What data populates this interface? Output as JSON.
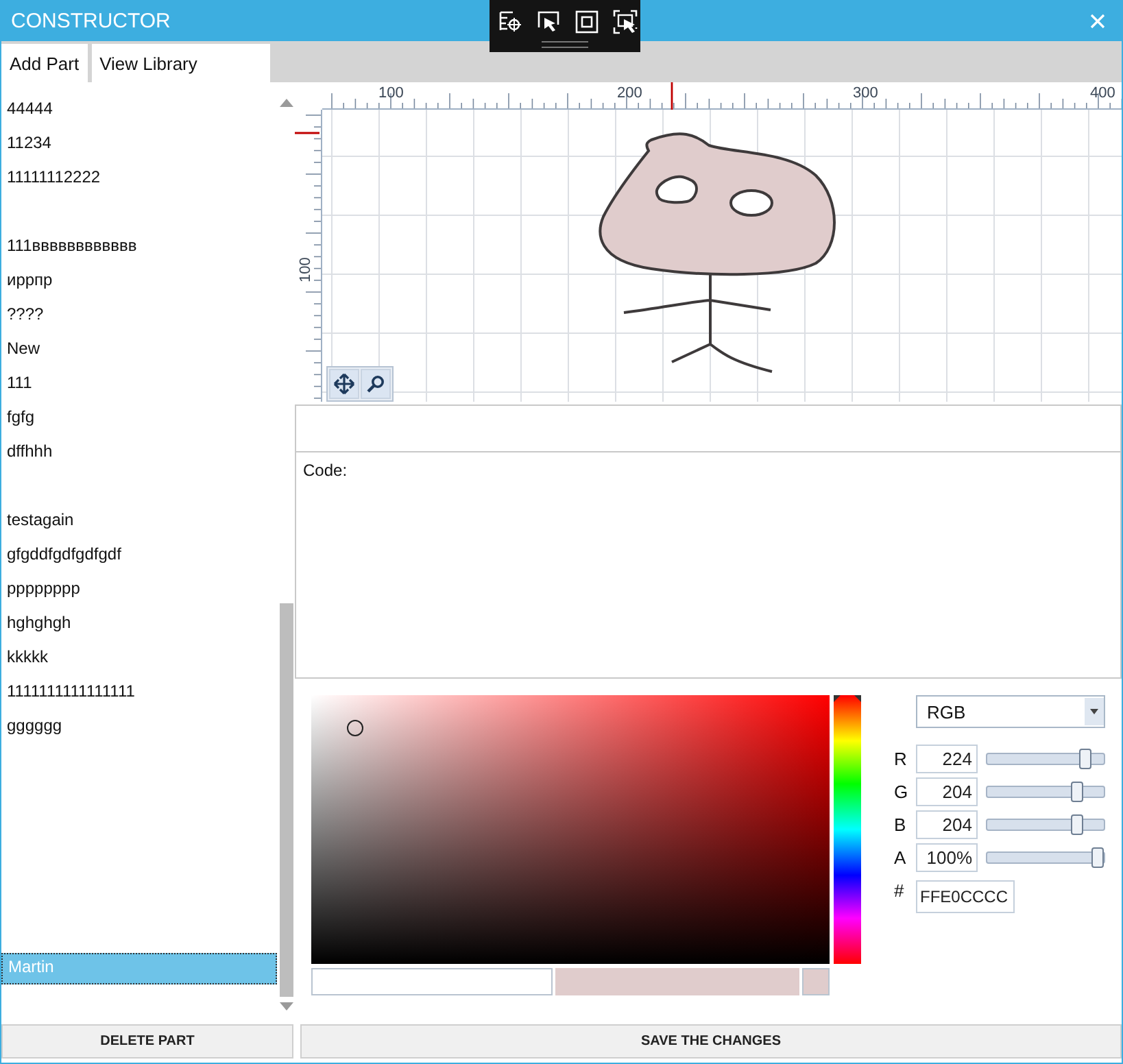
{
  "window": {
    "title": "CONSTRUCTOR"
  },
  "toolbar": [
    {
      "label": "Add Part"
    },
    {
      "label": "View Library"
    }
  ],
  "parts": [
    {
      "name": "44444",
      "spaced": false,
      "kind": "part",
      "selected": false
    },
    {
      "name": "11234",
      "spaced": false,
      "kind": "part",
      "selected": false
    },
    {
      "name": "11111112222",
      "spaced": false,
      "kind": "part",
      "selected": false
    },
    {
      "name": "111вввввввввввв",
      "spaced": true,
      "kind": "part",
      "selected": false
    },
    {
      "name": "иррпр",
      "spaced": false,
      "kind": "part",
      "selected": false
    },
    {
      "name": "????",
      "spaced": false,
      "kind": "part",
      "selected": false
    },
    {
      "name": "New",
      "spaced": false,
      "kind": "part",
      "selected": false
    },
    {
      "name": "111",
      "spaced": false,
      "kind": "part",
      "selected": false
    },
    {
      "name": "fgfg",
      "spaced": false,
      "kind": "part",
      "selected": false
    },
    {
      "name": "dffhhh",
      "spaced": false,
      "kind": "part",
      "selected": false
    },
    {
      "name": "testagain",
      "spaced": true,
      "kind": "part",
      "selected": false
    },
    {
      "name": "gfgddfgdfgdfgdf",
      "spaced": false,
      "kind": "part",
      "selected": false
    },
    {
      "name": "pppppppp",
      "spaced": false,
      "kind": "part",
      "selected": false
    },
    {
      "name": "hghghgh",
      "spaced": false,
      "kind": "part",
      "selected": false
    },
    {
      "name": "kkkkk",
      "spaced": false,
      "kind": "part",
      "selected": false
    },
    {
      "name": "1111111111111111",
      "spaced": false,
      "kind": "part",
      "selected": false
    },
    {
      "name": "gggggg",
      "spaced": false,
      "kind": "part",
      "selected": false
    },
    {
      "name": "Martin",
      "spaced": false,
      "kind": "pinned",
      "selected": true
    }
  ],
  "ruler": {
    "x_labels": [
      "100",
      "200",
      "300",
      "400"
    ],
    "y_labels": [
      "100"
    ]
  },
  "code": {
    "label": "Code:"
  },
  "color_picker": {
    "mode": "RGB",
    "hue": {
      "level": 0
    },
    "hex": "FFE0CCCC",
    "channels": [
      {
        "label": "R",
        "value": "224",
        "level": 0.878
      },
      {
        "label": "G",
        "value": "204",
        "level": 0.8
      },
      {
        "label": "B",
        "value": "204",
        "level": 0.8
      },
      {
        "label": "A",
        "value": "100%",
        "level": 1
      }
    ],
    "hex_label": "#"
  },
  "buttons": [
    {
      "label": "DELETE PART"
    },
    {
      "label": "SAVE THE CHANGES"
    }
  ]
}
